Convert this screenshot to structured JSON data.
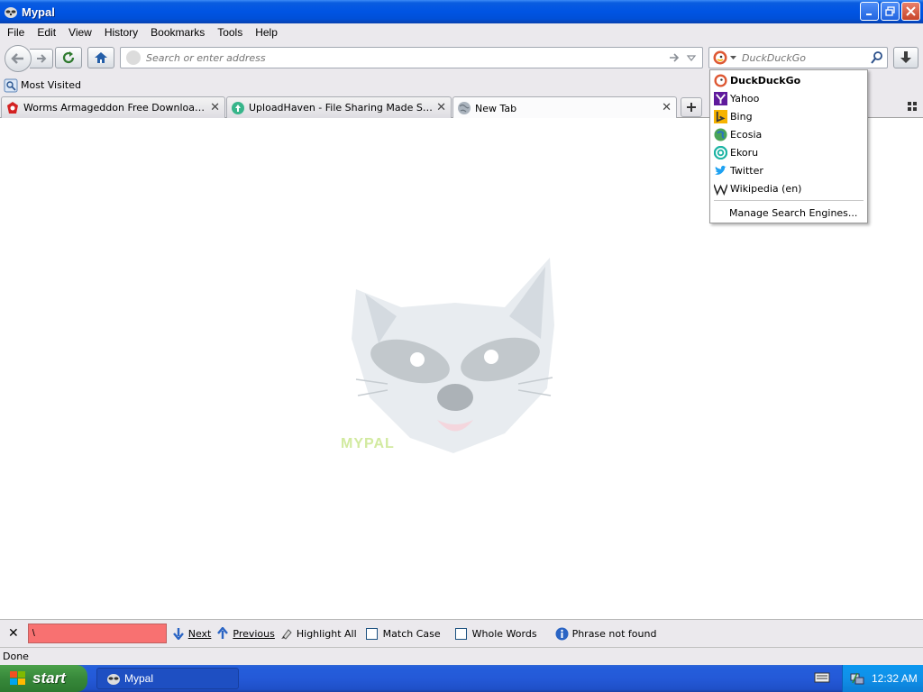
{
  "window": {
    "title": "Mypal"
  },
  "menu": [
    "File",
    "Edit",
    "View",
    "History",
    "Bookmarks",
    "Tools",
    "Help"
  ],
  "nav": {
    "url_placeholder": "Search or enter address",
    "search_placeholder": "DuckDuckGo"
  },
  "bookmarks": {
    "most_visited": "Most Visited"
  },
  "tabs": [
    {
      "label": "Worms Armageddon Free Download (GO..."
    },
    {
      "label": "UploadHaven - File Sharing Made Simple"
    },
    {
      "label": "New Tab"
    }
  ],
  "search_engines": {
    "items": [
      {
        "label": "DuckDuckGo"
      },
      {
        "label": "Yahoo"
      },
      {
        "label": "Bing"
      },
      {
        "label": "Ecosia"
      },
      {
        "label": "Ekoru"
      },
      {
        "label": "Twitter"
      },
      {
        "label": "Wikipedia (en)"
      }
    ],
    "manage": "Manage Search Engines..."
  },
  "content": {
    "watermark": "MYPAL"
  },
  "findbar": {
    "value": "\\",
    "next": "Next",
    "previous": "Previous",
    "highlight_all": "Highlight All",
    "match_case": "Match Case",
    "whole_words": "Whole Words",
    "status": "Phrase not found"
  },
  "status": {
    "text": "Done"
  },
  "taskbar": {
    "start": "start",
    "task": "Mypal",
    "clock": "12:32 AM"
  }
}
